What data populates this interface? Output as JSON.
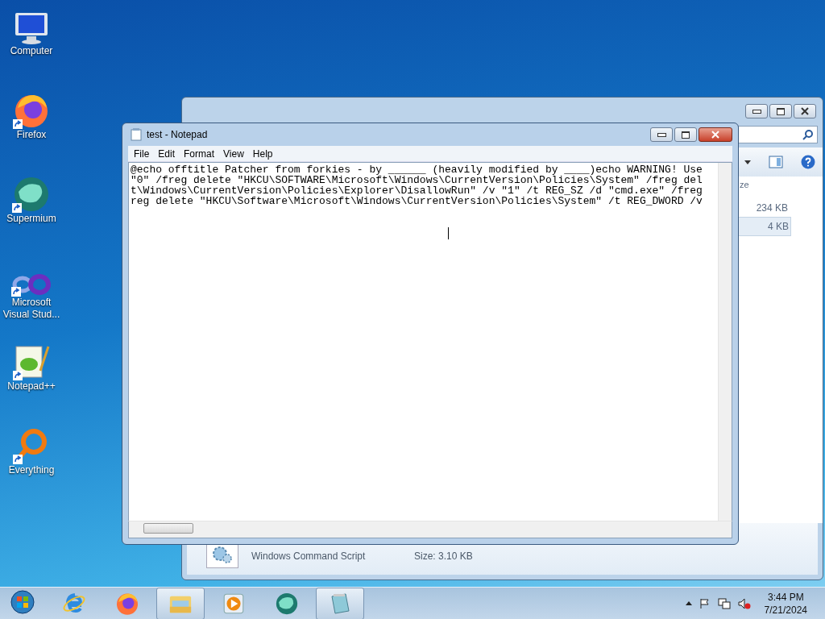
{
  "desktop_icons": [
    {
      "label": "Computer",
      "kind": "computer",
      "shortcut": false
    },
    {
      "label": "Firefox",
      "kind": "firefox",
      "shortcut": true
    },
    {
      "label": "Supermium",
      "kind": "supermium",
      "shortcut": true
    },
    {
      "label": "Microsoft Visual Stud...",
      "kind": "vs",
      "shortcut": true
    },
    {
      "label": "Notepad++",
      "kind": "notepadpp",
      "shortcut": true
    },
    {
      "label": "Everything",
      "kind": "everything",
      "shortcut": true
    }
  ],
  "explorer": {
    "column_fragment": "ze",
    "sizes": [
      "234 KB",
      "4 KB"
    ],
    "file_type": "Windows Command Script",
    "file_size": "Size: 3.10 KB"
  },
  "notepad": {
    "title": "test - Notepad",
    "menu": [
      "File",
      "Edit",
      "Format",
      "View",
      "Help"
    ],
    "lines": [
      "@echo offtitle Patcher from forkies - by ______ (heavily modified by ____)echo WARNING! Use",
      "\"0\" /freg delete \"HKCU\\SOFTWARE\\Microsoft\\Windows\\CurrentVersion\\Policies\\System\" /freg del",
      "t\\Windows\\CurrentVersion\\Policies\\Explorer\\DisallowRun\" /v \"1\" /t REG_SZ /d \"cmd.exe\" /freg",
      "reg delete \"HKCU\\Software\\Microsoft\\Windows\\CurrentVersion\\Policies\\System\" /t REG_DWORD /v"
    ]
  },
  "taskbar": {
    "apps": [
      {
        "kind": "ie",
        "running": false
      },
      {
        "kind": "firefox",
        "running": false
      },
      {
        "kind": "explorer",
        "running": true
      },
      {
        "kind": "media",
        "running": false
      },
      {
        "kind": "supermium",
        "running": false
      },
      {
        "kind": "notepad",
        "running": true
      }
    ],
    "time": "3:44 PM",
    "date": "7/21/2024"
  }
}
